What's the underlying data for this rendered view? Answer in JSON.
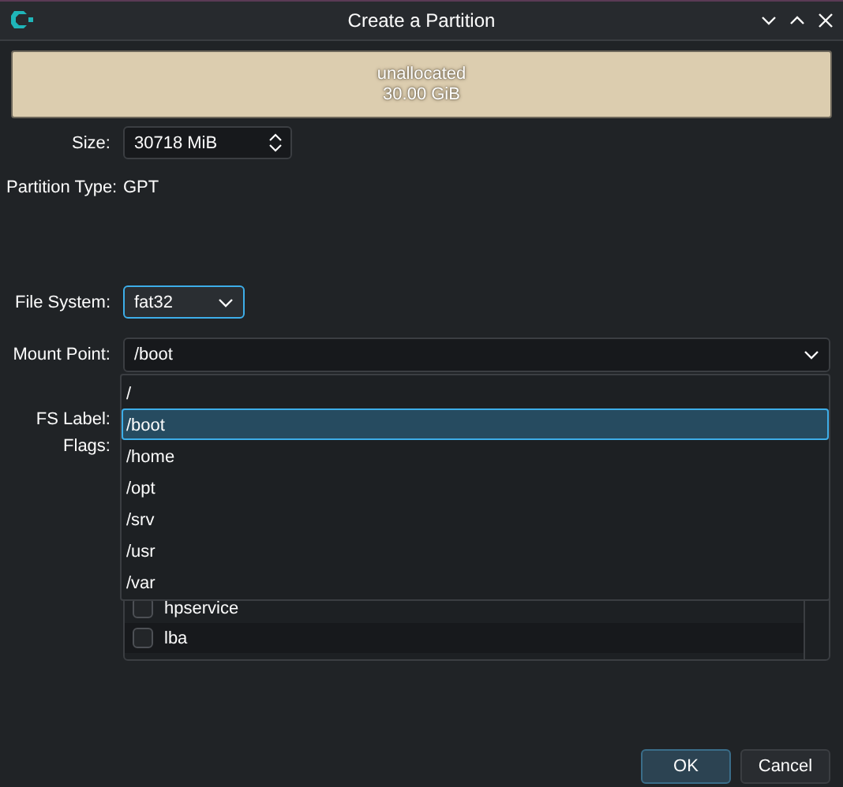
{
  "window": {
    "title": "Create a Partition"
  },
  "partition_bar": {
    "label": "unallocated",
    "size": "30.00 GiB"
  },
  "size": {
    "label": "Size:",
    "value": "30718 MiB"
  },
  "partition_type": {
    "label": "Partition Type:",
    "value": "GPT"
  },
  "file_system": {
    "label": "File System:",
    "value": "fat32",
    "focused": true
  },
  "mount_point": {
    "label": "Mount Point:",
    "value": "/boot",
    "focused": false,
    "expanded": true,
    "options": [
      {
        "label": "/",
        "selected": false
      },
      {
        "label": "/boot",
        "selected": true
      },
      {
        "label": "/home",
        "selected": false
      },
      {
        "label": "/opt",
        "selected": false
      },
      {
        "label": "/srv",
        "selected": false
      },
      {
        "label": "/usr",
        "selected": false
      },
      {
        "label": "/var",
        "selected": false
      }
    ]
  },
  "fs_label": {
    "label": "FS Label:"
  },
  "flags": {
    "label": "Flags:",
    "items": [
      {
        "label": "hpservice",
        "checked": false
      },
      {
        "label": "lba",
        "checked": false
      }
    ]
  },
  "buttons": [
    {
      "label": "OK",
      "default": true
    },
    {
      "label": "Cancel",
      "default": false
    }
  ]
}
